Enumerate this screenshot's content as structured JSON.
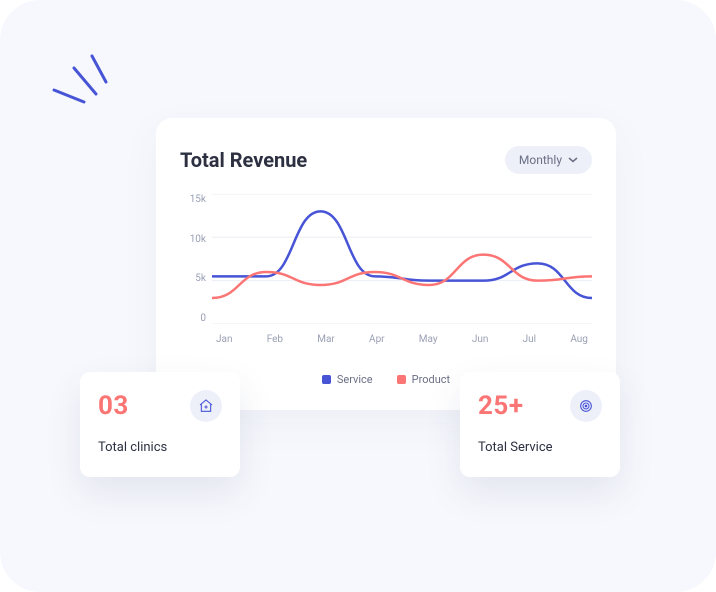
{
  "revenue": {
    "title": "Total Revenue",
    "dropdown_label": "Monthly"
  },
  "legend": {
    "service": "Service",
    "product": "Product"
  },
  "cards": {
    "clinics": {
      "value": "03",
      "label": "Total clinics"
    },
    "service": {
      "value": "25+",
      "label": "Total Service"
    }
  },
  "colors": {
    "service": "#4754D6",
    "product": "#FB7575"
  },
  "chart_data": {
    "type": "line",
    "title": "Total Revenue",
    "xlabel": "",
    "ylabel": "",
    "ylim": [
      0,
      15000
    ],
    "categories": [
      "Jan",
      "Feb",
      "Mar",
      "Apr",
      "May",
      "Jun",
      "Jul",
      "Aug"
    ],
    "y_ticks": [
      "15k",
      "10k",
      "5k",
      "0"
    ],
    "series": [
      {
        "name": "Service",
        "color": "#4754D6",
        "values": [
          5500,
          5500,
          13000,
          5500,
          5000,
          5000,
          7000,
          3000
        ]
      },
      {
        "name": "Product",
        "color": "#FB7575",
        "values": [
          3000,
          6000,
          4500,
          6000,
          4500,
          8000,
          5000,
          5500
        ]
      }
    ]
  }
}
